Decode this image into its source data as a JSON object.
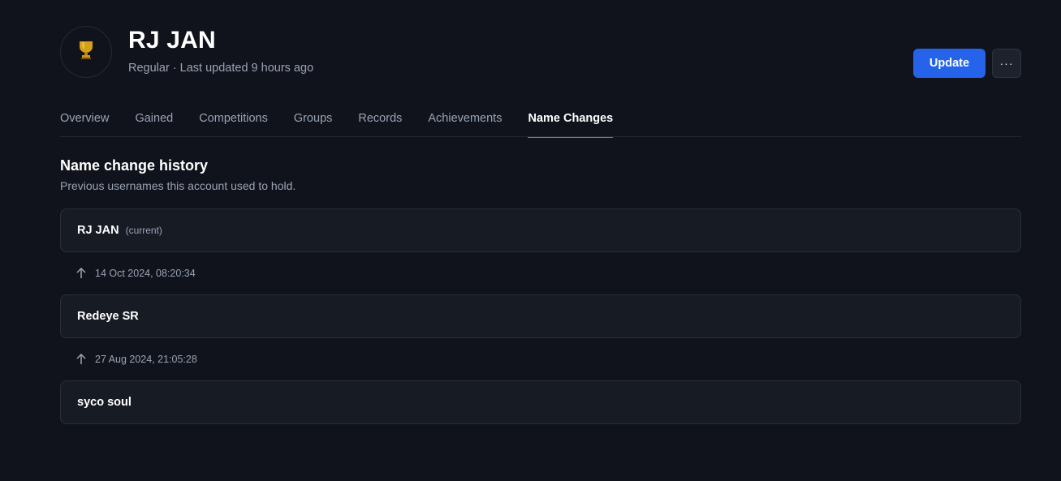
{
  "player": {
    "name": "RJ JAN",
    "subtitle": "Regular · Last updated 9 hours ago",
    "avatar_icon": "trophy-icon"
  },
  "actions": {
    "update_label": "Update",
    "more_label": "···"
  },
  "tabs": [
    {
      "label": "Overview",
      "active": false
    },
    {
      "label": "Gained",
      "active": false
    },
    {
      "label": "Competitions",
      "active": false
    },
    {
      "label": "Groups",
      "active": false
    },
    {
      "label": "Records",
      "active": false
    },
    {
      "label": "Achievements",
      "active": false
    },
    {
      "label": "Name Changes",
      "active": true
    }
  ],
  "section": {
    "title": "Name change history",
    "description": "Previous usernames this account used to hold."
  },
  "history": {
    "current_tag": "(current)",
    "names": [
      {
        "name": "RJ JAN"
      },
      {
        "name": "Redeye SR"
      },
      {
        "name": "syco soul"
      }
    ],
    "changes": [
      {
        "date": "14 Oct 2024, 08:20:34",
        "icon": "arrow-up-icon"
      },
      {
        "date": "27 Aug 2024, 21:05:28",
        "icon": "arrow-up-icon"
      }
    ]
  },
  "colors": {
    "background": "#10131b",
    "accent": "#2563eb",
    "tab_indicator": "#3b82f6",
    "card": "#171b24",
    "muted_text": "#9aa3b5",
    "trophy": "#d4a017"
  }
}
